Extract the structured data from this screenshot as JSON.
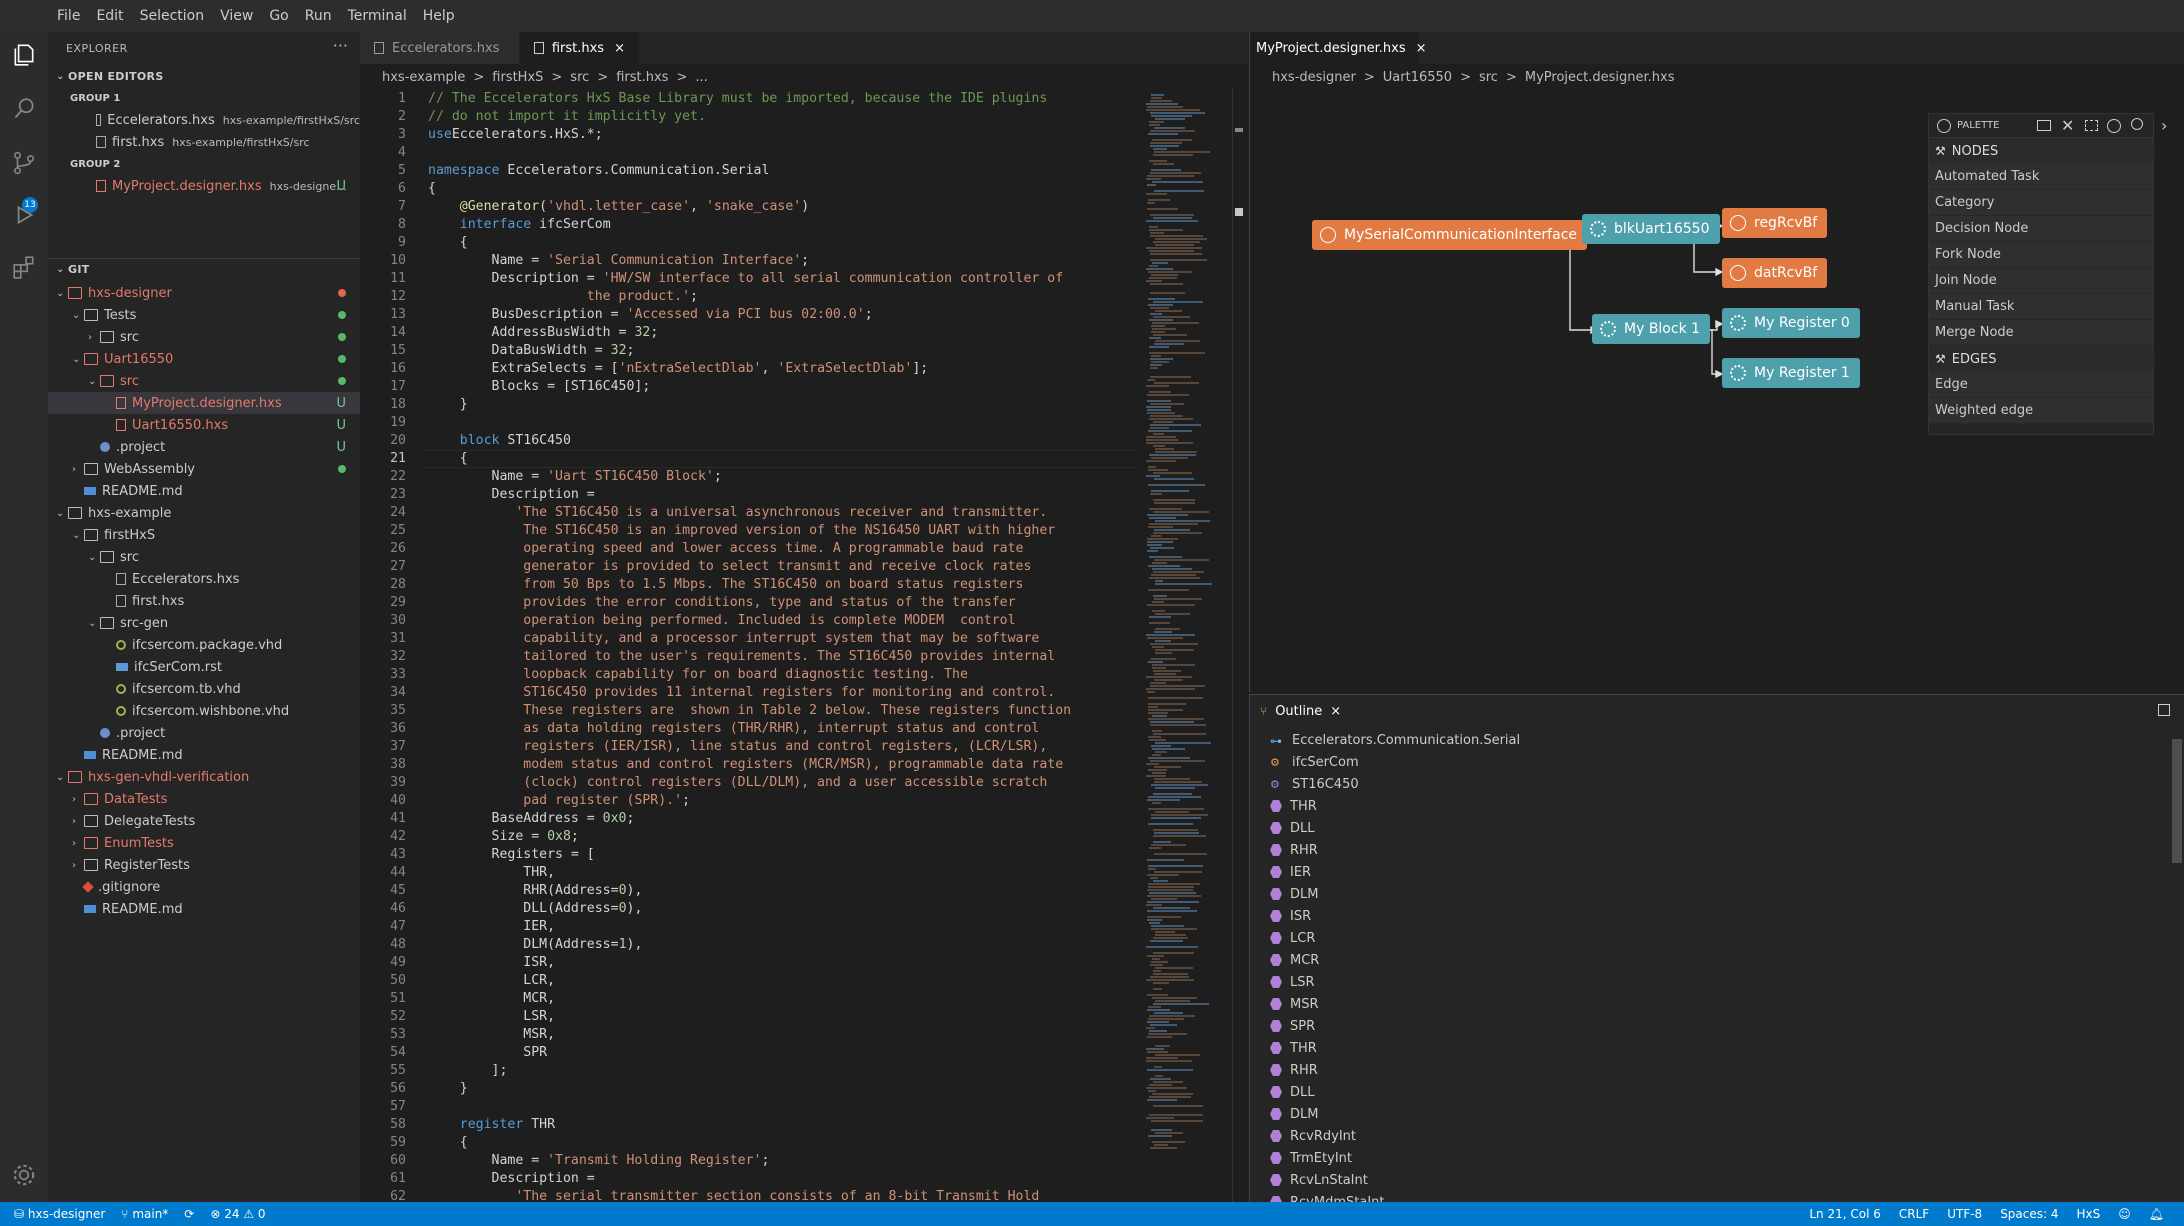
{
  "menu": [
    "File",
    "Edit",
    "Selection",
    "View",
    "Go",
    "Run",
    "Terminal",
    "Help"
  ],
  "explorer": {
    "title": "EXPLORER",
    "more": "···",
    "open_editors": "OPEN EDITORS",
    "group1": "GROUP 1",
    "group2": "GROUP 2",
    "oe": [
      {
        "name": "Eccelerators.hxs",
        "desc": "hxs-example/firstHxS/src"
      },
      {
        "name": "first.hxs",
        "desc": "hxs-example/firstHxS/src"
      },
      {
        "name": "MyProject.designer.hxs",
        "desc": "hxs-designe...",
        "status": "U"
      }
    ],
    "git": "GIT",
    "tree": [
      {
        "label": "hxs-designer",
        "red": true
      },
      {
        "label": "Tests"
      },
      {
        "label": "src"
      },
      {
        "label": "Uart16550",
        "red": true
      },
      {
        "label": "src",
        "red": true
      },
      {
        "label": "MyProject.designer.hxs",
        "red": true,
        "status": "U"
      },
      {
        "label": "Uart16550.hxs",
        "red": true,
        "status": "U"
      },
      {
        "label": ".project",
        "status": "U"
      },
      {
        "label": "WebAssembly"
      },
      {
        "label": "README.md"
      },
      {
        "label": "hxs-example"
      },
      {
        "label": "firstHxS"
      },
      {
        "label": "src"
      },
      {
        "label": "Eccelerators.hxs"
      },
      {
        "label": "first.hxs"
      },
      {
        "label": "src-gen"
      },
      {
        "label": "ifcsercom.package.vhd"
      },
      {
        "label": "ifcSerCom.rst"
      },
      {
        "label": "ifcsercom.tb.vhd"
      },
      {
        "label": "ifcsercom.wishbone.vhd"
      },
      {
        "label": ".project"
      },
      {
        "label": "README.md"
      },
      {
        "label": "hxs-gen-vhdl-verification",
        "red": true
      },
      {
        "label": "DataTests",
        "red": true
      },
      {
        "label": "DelegateTests"
      },
      {
        "label": "EnumTests",
        "red": true
      },
      {
        "label": "RegisterTests"
      },
      {
        "label": ".gitignore"
      },
      {
        "label": "README.md"
      }
    ]
  },
  "activity": {
    "badge": "13"
  },
  "editor1": {
    "tabs": [
      "Eccelerators.hxs",
      "first.hxs"
    ],
    "close": "×",
    "breadcrumb": [
      "hxs-example",
      ">",
      "firstHxS",
      ">",
      "src",
      ">",
      "first.hxs",
      ">",
      "..."
    ],
    "lines": [
      [
        [
          "cm",
          "// The Eccelerators HxS Base Library must be imported, because the IDE plugins"
        ]
      ],
      [
        [
          "cm",
          "// do not import it implicitly yet."
        ]
      ],
      [
        [
          "kw",
          "use"
        ],
        [
          "",
          "Eccelerators.HxS.*;"
        ]
      ],
      [],
      [
        [
          "kw",
          "namespace"
        ],
        [
          "",
          " Eccelerators.Communication.Serial"
        ]
      ],
      [
        [
          "",
          "{"
        ]
      ],
      [
        [
          "",
          "    "
        ],
        [
          "dec",
          "@Generator"
        ],
        [
          "",
          "("
        ],
        [
          "str",
          "'vhdl.letter_case'"
        ],
        [
          "",
          ", "
        ],
        [
          "str",
          "'snake_case'"
        ],
        [
          "",
          ")"
        ]
      ],
      [
        [
          "",
          "    "
        ],
        [
          "kw",
          "interface"
        ],
        [
          "",
          " ifcSerCom"
        ]
      ],
      [
        [
          "",
          "    {"
        ]
      ],
      [
        [
          "",
          "        Name = "
        ],
        [
          "str",
          "'Serial Communication Interface'"
        ],
        [
          "",
          ";"
        ]
      ],
      [
        [
          "",
          "        Description = "
        ],
        [
          "str",
          "'HW/SW interface to all serial communication controller of"
        ]
      ],
      [
        [
          "str",
          "                    the product.'"
        ],
        [
          "",
          ";"
        ]
      ],
      [
        [
          "",
          "        BusDescription = "
        ],
        [
          "str",
          "'Accessed via PCI bus 02:00.0'"
        ],
        [
          "",
          ";"
        ]
      ],
      [
        [
          "",
          "        AddressBusWidth = "
        ],
        [
          "num",
          "32"
        ],
        [
          "",
          ";"
        ]
      ],
      [
        [
          "",
          "        DataBusWidth = "
        ],
        [
          "num",
          "32"
        ],
        [
          "",
          ";"
        ]
      ],
      [
        [
          "",
          "        ExtraSelects = ["
        ],
        [
          "str",
          "'nExtraSelectDlab'"
        ],
        [
          "",
          ", "
        ],
        [
          "str",
          "'ExtraSelectDlab'"
        ],
        [
          "",
          "];"
        ]
      ],
      [
        [
          "",
          "        Blocks = [ST16C450];"
        ]
      ],
      [
        [
          "",
          "    }"
        ]
      ],
      [],
      [
        [
          "",
          "    "
        ],
        [
          "kw",
          "block"
        ],
        [
          "",
          " ST16C450"
        ]
      ],
      [
        [
          "",
          "    {"
        ]
      ],
      [
        [
          "",
          "        Name = "
        ],
        [
          "str",
          "'Uart ST16C450 Block'"
        ],
        [
          "",
          ";"
        ]
      ],
      [
        [
          "",
          "        Description ="
        ]
      ],
      [
        [
          "str",
          "           'The ST16C450 is a universal asynchronous receiver and transmitter."
        ]
      ],
      [
        [
          "str",
          "            The ST16C450 is an improved version of the NS16450 UART with higher"
        ]
      ],
      [
        [
          "str",
          "            operating speed and lower access time. A programmable baud rate"
        ]
      ],
      [
        [
          "str",
          "            generator is provided to select transmit and receive clock rates"
        ]
      ],
      [
        [
          "str",
          "            from 50 Bps to 1.5 Mbps. The ST16C450 on board status registers"
        ]
      ],
      [
        [
          "str",
          "            provides the error conditions, type and status of the transfer"
        ]
      ],
      [
        [
          "str",
          "            operation being performed. Included is complete MODEM  control"
        ]
      ],
      [
        [
          "str",
          "            capability, and a processor interrupt system that may be software"
        ]
      ],
      [
        [
          "str",
          "            tailored to the user's requirements. The ST16C450 provides internal"
        ]
      ],
      [
        [
          "str",
          "            loopback capability for on board diagnostic testing. The"
        ]
      ],
      [
        [
          "str",
          "            ST16C450 provides 11 internal registers for monitoring and control."
        ]
      ],
      [
        [
          "str",
          "            These registers are  shown in Table 2 below. These registers function"
        ]
      ],
      [
        [
          "str",
          "            as data holding registers (THR/RHR), interrupt status and control"
        ]
      ],
      [
        [
          "str",
          "            registers (IER/ISR), line status and control registers, (LCR/LSR),"
        ]
      ],
      [
        [
          "str",
          "            modem status and control registers (MCR/MSR), programmable data rate"
        ]
      ],
      [
        [
          "str",
          "            (clock) control registers (DLL/DLM), and a user accessible scratch"
        ]
      ],
      [
        [
          "str",
          "            pad register (SPR).'"
        ],
        [
          "",
          ";"
        ]
      ],
      [
        [
          "",
          "        BaseAddress = "
        ],
        [
          "num",
          "0x0"
        ],
        [
          "",
          ";"
        ]
      ],
      [
        [
          "",
          "        Size = "
        ],
        [
          "num",
          "0x8"
        ],
        [
          "",
          ";"
        ]
      ],
      [
        [
          "",
          "        Registers = ["
        ]
      ],
      [
        [
          "",
          "            THR,"
        ]
      ],
      [
        [
          "",
          "            RHR(Address="
        ],
        [
          "num",
          "0"
        ],
        [
          "",
          "),"
        ]
      ],
      [
        [
          "",
          "            DLL(Address="
        ],
        [
          "num",
          "0"
        ],
        [
          "",
          "),"
        ]
      ],
      [
        [
          "",
          "            IER,"
        ]
      ],
      [
        [
          "",
          "            DLM(Address="
        ],
        [
          "num",
          "1"
        ],
        [
          "",
          "),"
        ]
      ],
      [
        [
          "",
          "            ISR,"
        ]
      ],
      [
        [
          "",
          "            LCR,"
        ]
      ],
      [
        [
          "",
          "            MCR,"
        ]
      ],
      [
        [
          "",
          "            LSR,"
        ]
      ],
      [
        [
          "",
          "            MSR,"
        ]
      ],
      [
        [
          "",
          "            SPR"
        ]
      ],
      [
        [
          "",
          "        ];"
        ]
      ],
      [
        [
          "",
          "    }"
        ]
      ],
      [],
      [
        [
          "",
          "    "
        ],
        [
          "kw",
          "register"
        ],
        [
          "",
          " THR"
        ]
      ],
      [
        [
          "",
          "    {"
        ]
      ],
      [
        [
          "",
          "        Name = "
        ],
        [
          "str",
          "'Transmit Holding Register'"
        ],
        [
          "",
          ";"
        ]
      ],
      [
        [
          "",
          "        Description ="
        ]
      ],
      [
        [
          "str",
          "           'The serial transmitter section consists of an 8-bit Transmit Hold"
        ]
      ]
    ]
  },
  "editor2": {
    "tab": "MyProject.designer.hxs",
    "close": "×",
    "breadcrumb": [
      "hxs-designer",
      ">",
      "Uart16550",
      ">",
      "src",
      ">",
      "MyProject.designer.hxs"
    ],
    "nodes": [
      {
        "label": "MySerialCommunicationInterface",
        "kind": "interface",
        "color": "#e27b43"
      },
      {
        "label": "blkUart16550",
        "kind": "block",
        "color": "#4fa0ad"
      },
      {
        "label": "regRcvBf",
        "kind": "register",
        "color": "#e27b43"
      },
      {
        "label": "datRcvBf",
        "kind": "register",
        "color": "#e27b43"
      },
      {
        "label": "My Block 1",
        "kind": "block",
        "color": "#4fa0ad"
      },
      {
        "label": "My Register 0",
        "kind": "register",
        "color": "#4fa0ad"
      },
      {
        "label": "My Register 1",
        "kind": "register",
        "color": "#4fa0ad"
      }
    ],
    "palette": {
      "title": "PALETTE",
      "nodes_label": "NODES",
      "nodes": [
        "Automated Task",
        "Category",
        "Decision Node",
        "Fork Node",
        "Join Node",
        "Manual Task",
        "Merge Node"
      ],
      "edges_label": "EDGES",
      "edges": [
        "Edge",
        "Weighted edge"
      ]
    }
  },
  "outline": {
    "title": "Outline",
    "close": "×",
    "items": [
      "Eccelerators.Communication.Serial",
      "ifcSerCom",
      "ST16C450",
      "THR",
      "DLL",
      "RHR",
      "IER",
      "DLM",
      "ISR",
      "LCR",
      "MCR",
      "LSR",
      "MSR",
      "SPR",
      "THR",
      "RHR",
      "DLL",
      "DLM",
      "RcvRdyInt",
      "TrmEtyInt",
      "RcvLnStaInt",
      "RcvMdmStaInt"
    ]
  },
  "status": {
    "branch_repo": "hxs-designer",
    "branch": "main*",
    "errors": "24",
    "warnings": "0",
    "position": "Ln 21, Col 6",
    "eol": "CRLF",
    "encoding": "UTF-8",
    "spaces": "Spaces: 4",
    "language": "HxS"
  }
}
